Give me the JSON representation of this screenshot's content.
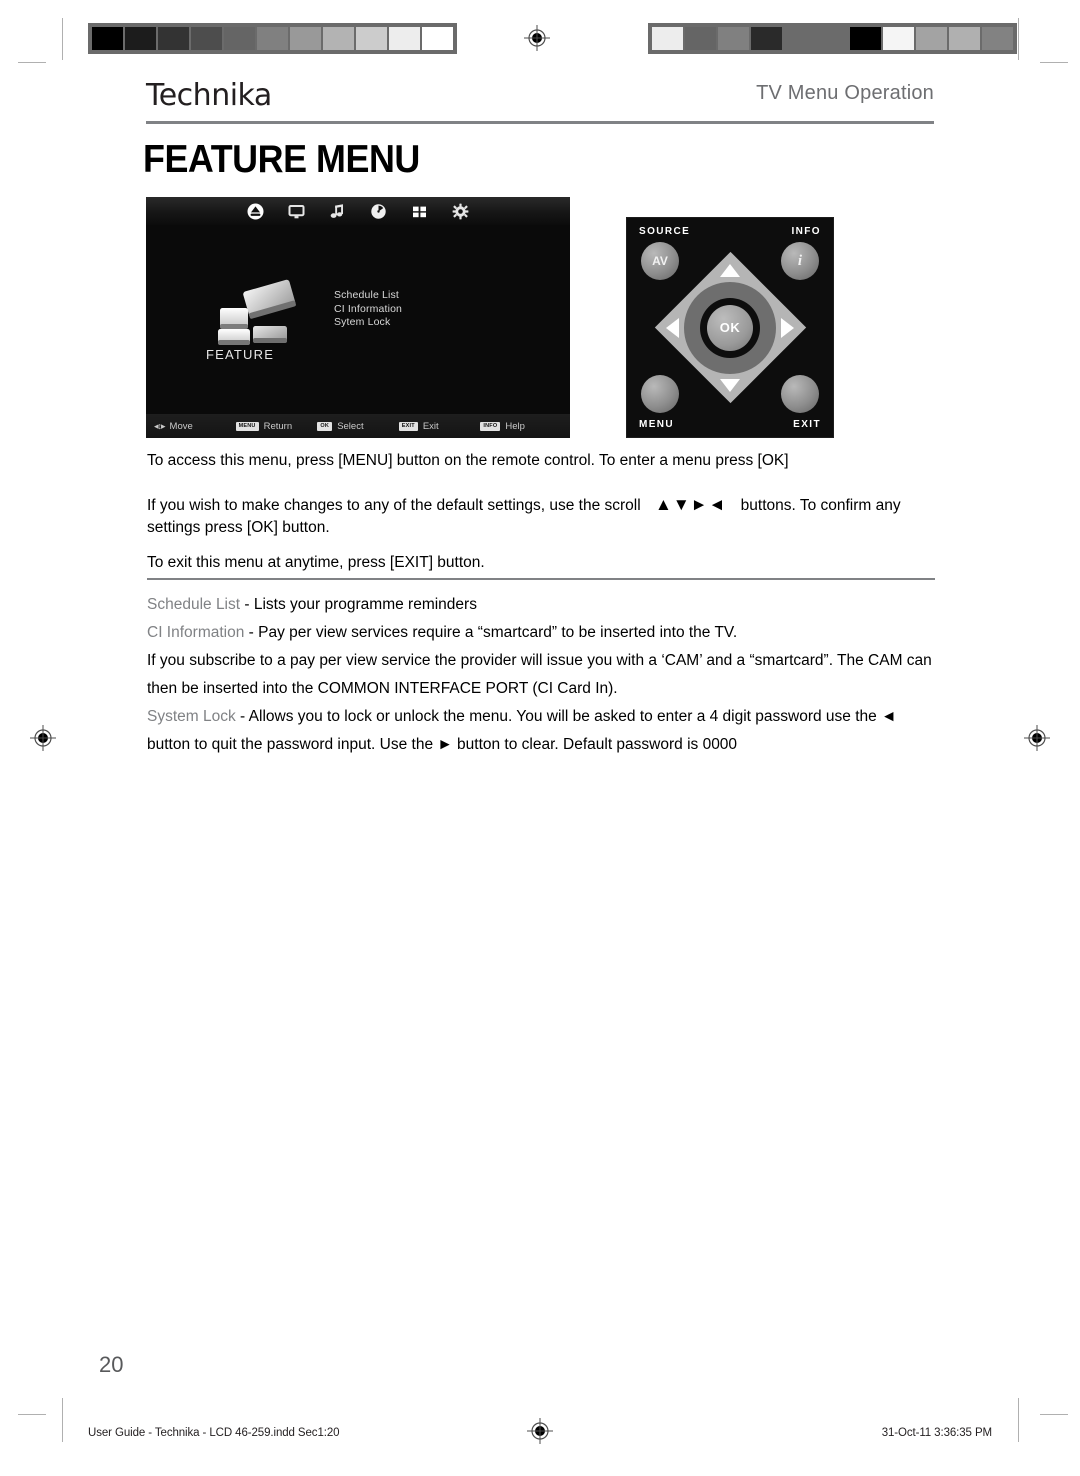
{
  "printer_marks": {
    "left_colorbar": [
      "#000000",
      "#1c1c1c",
      "#333333",
      "#4d4d4d",
      "#656565",
      "#808080",
      "#999999",
      "#b3b3b3",
      "#cccccc",
      "#ededed",
      "#ffffff"
    ],
    "right_colorbar": [
      "#ededed",
      "#656565",
      "#808080",
      "#2a2a2a",
      "#6b6b6b",
      "#6b6b6b",
      "#000000",
      "#f5f5f5",
      "#a3a3a3",
      "#b0b0b0",
      "#828282"
    ],
    "registration_icon": "registration-target-icon"
  },
  "header": {
    "brand": "Technika",
    "section": "TV Menu Operation"
  },
  "heading": "FEATURE MENU",
  "osd": {
    "top_icons": [
      {
        "name": "channel-antenna-icon",
        "active": false
      },
      {
        "name": "picture-monitor-icon",
        "active": false
      },
      {
        "name": "sound-music-note-icon",
        "active": false
      },
      {
        "name": "time-clock-icon",
        "active": false
      },
      {
        "name": "feature-grid-icon",
        "active": true
      },
      {
        "name": "setup-gear-icon",
        "active": false
      }
    ],
    "feature_label": "FEATURE",
    "menu_items": [
      "Schedule List",
      "CI Information",
      "Sytem Lock"
    ],
    "hints": [
      {
        "key": "",
        "glyph": "move-arrows-icon",
        "label": "Move"
      },
      {
        "key": "MENU",
        "glyph": "",
        "label": "Return"
      },
      {
        "key": "OK",
        "glyph": "",
        "label": "Select"
      },
      {
        "key": "EXIT",
        "glyph": "",
        "label": "Exit"
      },
      {
        "key": "INFO",
        "glyph": "",
        "label": "Help"
      }
    ]
  },
  "remote": {
    "source_label": "SOURCE",
    "source_button": "AV",
    "info_label": "INFO",
    "info_button": "i",
    "ok_button": "OK",
    "menu_label": "MENU",
    "exit_label": "EXIT"
  },
  "body": {
    "para1": "To access this menu, press [MENU] button on the remote control. To enter a menu press [OK]",
    "para2_before": "If you wish to make changes to any of the default settings, use the scroll",
    "para2_arrows": "▲▼►◄",
    "para2_after": "buttons. To confirm any settings press [OK] button.",
    "para3": "To exit this menu at anytime, press [EXIT] button."
  },
  "glossary": [
    {
      "term": "Schedule List",
      "sep": " - ",
      "desc": "Lists your programme reminders"
    },
    {
      "term": "CI Information",
      "sep": " - ",
      "desc": "Pay per view services require a “smartcard” to be inserted into the TV."
    },
    {
      "term": "",
      "sep": "",
      "desc": "If you subscribe to a pay per view service the provider will issue you with a ‘CAM’ and a “smartcard”. The CAM can then be inserted into the COMMON INTERFACE PORT (CI Card In)."
    },
    {
      "term": "System Lock",
      "sep": " - ",
      "desc": "Allows you to lock or unlock the menu. You will be asked to enter a 4 digit password use the ◄ button to quit the password input. Use the ► button to clear. Default password is 0000"
    }
  ],
  "footer": {
    "page_number": "20",
    "file_info": "User Guide - Technika - LCD 46-259.indd   Sec1:20",
    "timestamp": "31-Oct-11   3:36:35 PM"
  }
}
